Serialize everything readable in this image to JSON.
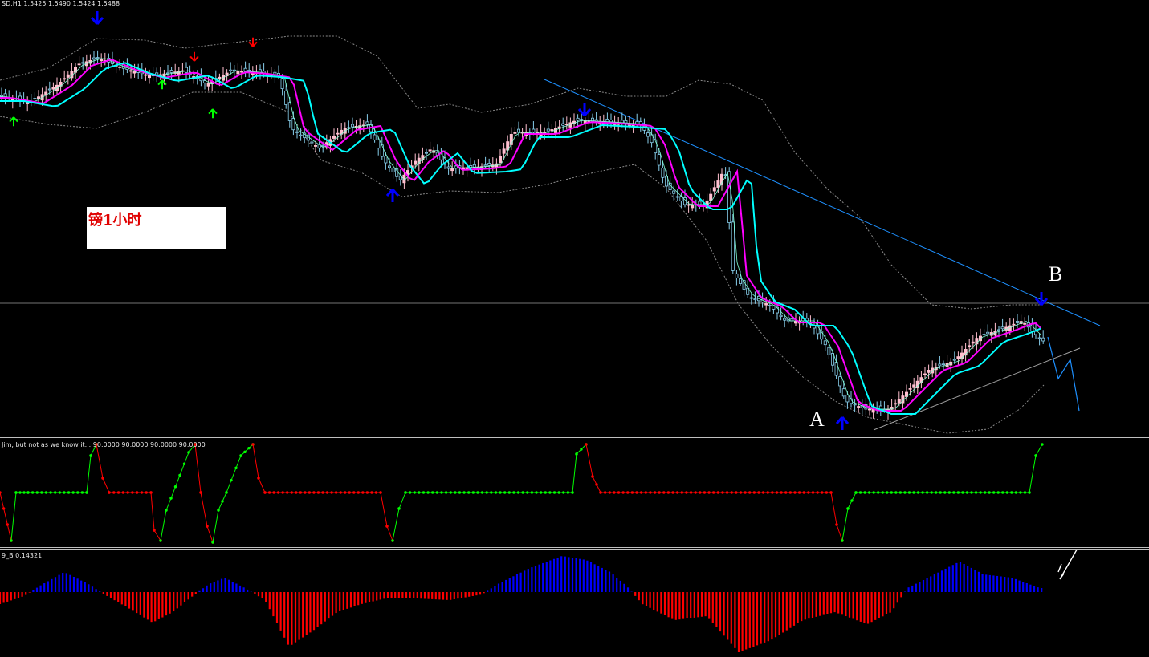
{
  "main": {
    "header": "SD,H1  1.5425 1.5490 1.5424 1.5488",
    "note": "镑1小时",
    "label_a": "A",
    "label_b": "B"
  },
  "indicator1": {
    "header": "Jim, but not as we know it... 90.0000 90.0000 90.0000 90.0000"
  },
  "indicator2": {
    "header": "9_B 0.14321"
  },
  "colors": {
    "up_candle": "#ffc0d0",
    "down_candle": "#87ceeb",
    "ma_fast": "#ff00ff",
    "ma_slow": "#00ffff",
    "band": "#808080",
    "trendline": "#1e90ff",
    "arrow_up_buy": "#0000ff",
    "arrow_down_sell": "#ff0000",
    "histogram_positive": "#0000ff",
    "histogram_negative": "#ff0000",
    "stoch_up": "#00ff00",
    "stoch_down": "#ff0000"
  },
  "icons": {
    "big_arrow_up": "arrow-up-icon",
    "big_arrow_down": "arrow-down-icon"
  }
}
